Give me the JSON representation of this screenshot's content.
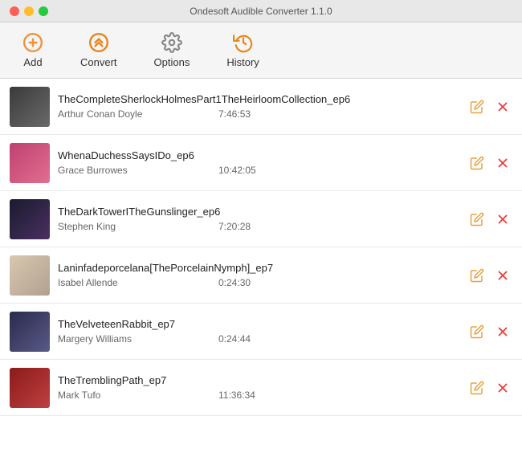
{
  "window": {
    "title": "Ondesoft Audible Converter 1.1.0"
  },
  "toolbar": {
    "add_label": "Add",
    "convert_label": "Convert",
    "options_label": "Options",
    "history_label": "History"
  },
  "tracks": [
    {
      "id": 1,
      "title": "TheCompleteSherlockHolmesPart1TheHeirloomCollection_ep6",
      "author": "Arthur Conan Doyle",
      "duration": "7:46:53",
      "thumb_class": "thumb-1"
    },
    {
      "id": 2,
      "title": "WhenaDuchessSaysIDo_ep6",
      "author": "Grace Burrowes",
      "duration": "10:42:05",
      "thumb_class": "thumb-2"
    },
    {
      "id": 3,
      "title": "TheDarkTowerITheGunslinger_ep6",
      "author": "Stephen King",
      "duration": "7:20:28",
      "thumb_class": "thumb-3"
    },
    {
      "id": 4,
      "title": "Laninfadeporcelana[ThePorcelainNymph]_ep7",
      "author": "Isabel Allende",
      "duration": "0:24:30",
      "thumb_class": "thumb-4"
    },
    {
      "id": 5,
      "title": "TheVelveteenRabbit_ep7",
      "author": "Margery Williams",
      "duration": "0:24:44",
      "thumb_class": "thumb-5"
    },
    {
      "id": 6,
      "title": "TheTremblingPath_ep7",
      "author": "Mark Tufo",
      "duration": "11:36:34",
      "thumb_class": "thumb-6"
    }
  ]
}
